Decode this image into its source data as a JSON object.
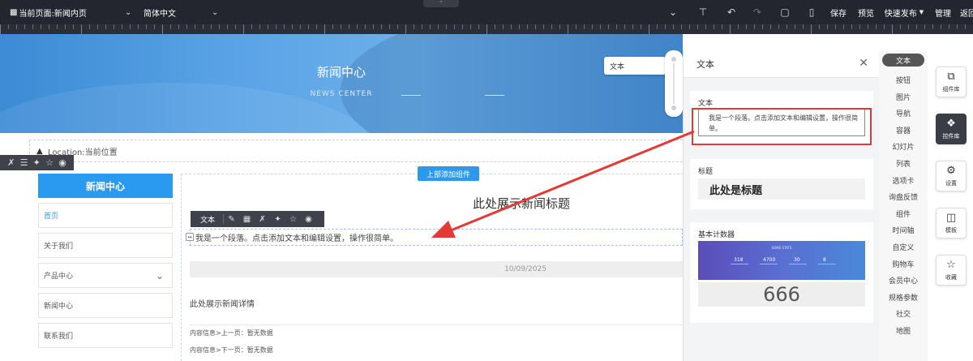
{
  "topbar": {
    "page_select": "当前页面:新闻内页",
    "lang_select": "简体中文",
    "save": "保存",
    "preview": "预览",
    "quick_publish": "快速发布",
    "manage": "管理",
    "back": "返回"
  },
  "banner": {
    "title": "新闻中心",
    "subtitle": "NEWS CENTER"
  },
  "location": "Location:当前位置",
  "sidebar_nav": {
    "header": "新闻中心",
    "items": [
      {
        "label": "首页"
      },
      {
        "label": "关于我们"
      },
      {
        "label": "产品中心"
      },
      {
        "label": "新闻中心"
      },
      {
        "label": "联系我们"
      }
    ]
  },
  "content": {
    "add_top_button": "上部添加组件",
    "news_title": "此处展示新闻标题",
    "toolbar_label": "文本",
    "paragraph": "我是一个段落。点击添加文本和编辑设置，操作很简单。",
    "date": "10/09/2025",
    "detail": "此处展示新闻详情",
    "prev": "内容信息>上一页：暂无数据",
    "next": "内容信息>下一页：暂无数据"
  },
  "floating_label": "文本",
  "panel": {
    "title": "文本",
    "text_card": {
      "title": "文本",
      "sample": "我是一个段落。点击添加文本和编辑设置，操作很简单。"
    },
    "heading_card": {
      "title": "标题",
      "sample": "此处是标题"
    },
    "counter_card": {
      "title": "基本计数器",
      "stats_title": "SOME STATS",
      "values": [
        "318",
        "4700",
        "30",
        "8"
      ],
      "big_value": "666"
    }
  },
  "categories": [
    "文本",
    "按钮",
    "图片",
    "导航",
    "容器",
    "幻灯片",
    "列表",
    "选项卡",
    "询盘反馈",
    "组件",
    "时间轴",
    "自定义",
    "购物车",
    "会员中心",
    "规格参数",
    "社交",
    "地图"
  ],
  "right_tools": [
    {
      "label": "组件库",
      "icon": "copy-icon"
    },
    {
      "label": "控件库",
      "icon": "puzzle-icon"
    },
    {
      "label": "设置",
      "icon": "gear-icon"
    },
    {
      "label": "模板",
      "icon": "layout-icon"
    },
    {
      "label": "收藏",
      "icon": "star-icon"
    }
  ],
  "colors": {
    "accent": "#2a9af0",
    "topbar": "#23252f",
    "highlight": "#e53935"
  }
}
